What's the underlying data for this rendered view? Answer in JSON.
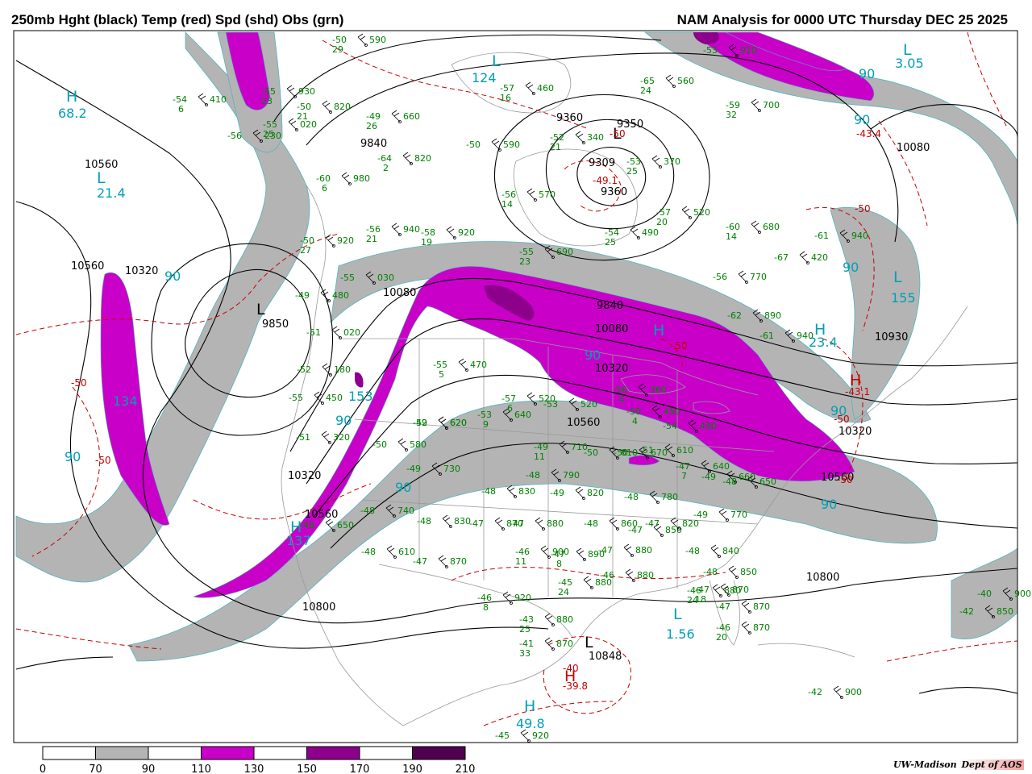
{
  "header": {
    "left_title": "250mb Hght (black) Temp (red) Spd (shd) Obs (grn)",
    "right_title": "NAM Analysis for 0000 UTC Thursday  DEC 25 2025"
  },
  "credit": {
    "org": "UW-Madison",
    "dept": "Dept of AOS"
  },
  "colors": {
    "speed_70_90": "#b4b4b4",
    "speed_110_130": "#c800c8",
    "speed_150_170": "#8c008c",
    "speed_190_210": "#500050",
    "height": "#000000",
    "temperature": "#c80000",
    "observations": "#008000",
    "speed_labels": "#00a0b4",
    "borders": "#999999"
  },
  "legend": {
    "ticks": [
      "0",
      "70",
      "90",
      "110",
      "130",
      "150",
      "170",
      "190",
      "210"
    ],
    "swatches": [
      "#ffffff",
      "#b4b4b4",
      "#ffffff",
      "#c800c8",
      "#ffffff",
      "#8c008c",
      "#ffffff",
      "#500050",
      "#ffffff"
    ]
  },
  "height_labels": [
    "10560",
    "9840",
    "10560",
    "10320",
    "9850",
    "9360",
    "9350",
    "9309",
    "9360",
    "10080",
    "9840",
    "10080",
    "10320",
    "10560",
    "10080",
    "10930",
    "10320",
    "10560",
    "10320",
    "10560",
    "10800",
    "10800",
    "10848"
  ],
  "speed_labels": [
    "68.2",
    "21.4",
    "90",
    "124",
    "90",
    "134",
    "90",
    "153",
    "90",
    "90",
    "137",
    "90",
    "3.05",
    "90",
    "90",
    "155",
    "23.4",
    "90",
    "90",
    "1.56",
    "49.8"
  ],
  "pressure_centers": [
    {
      "letter": "H",
      "kind": "speed"
    },
    {
      "letter": "L",
      "kind": "speed"
    },
    {
      "letter": "L",
      "kind": "height"
    },
    {
      "letter": "L",
      "kind": "height"
    },
    {
      "letter": "L",
      "kind": "speed"
    },
    {
      "letter": "H",
      "kind": "speed"
    },
    {
      "letter": "H",
      "kind": "speed"
    },
    {
      "letter": "L",
      "kind": "speed"
    },
    {
      "letter": "H",
      "kind": "speed"
    },
    {
      "letter": "L",
      "kind": "speed"
    },
    {
      "letter": "H",
      "kind": "temperature"
    },
    {
      "letter": "H",
      "kind": "temperature"
    },
    {
      "letter": "L",
      "kind": "height"
    },
    {
      "letter": "L",
      "kind": "speed"
    },
    {
      "letter": "H",
      "kind": "speed"
    }
  ],
  "temperature_labels": [
    "-50",
    "-50",
    "-49.1",
    "-50",
    "-43.4",
    "-50",
    "-50",
    "-43.1",
    "-50",
    "-50",
    "-40",
    "-39.8"
  ],
  "observations": [
    {
      "temp": "-54",
      "hgt": "410",
      "dew": "6"
    },
    {
      "temp": "-50",
      "hgt": "590",
      "dew": "29"
    },
    {
      "temp": "-55",
      "hgt": "930",
      "dew": "23"
    },
    {
      "temp": "-50",
      "hgt": "820",
      "dew": "21"
    },
    {
      "temp": "-55",
      "hgt": "020",
      "dew": "25"
    },
    {
      "temp": "-56",
      "hgt": "230",
      "dew": ""
    },
    {
      "temp": "-49",
      "hgt": "660",
      "dew": "26"
    },
    {
      "temp": "-64",
      "hgt": "820",
      "dew": "2"
    },
    {
      "temp": "-60",
      "hgt": "980",
      "dew": "6"
    },
    {
      "temp": "-56",
      "hgt": "940",
      "dew": "21"
    },
    {
      "temp": "-50",
      "hgt": "920",
      "dew": "27"
    },
    {
      "temp": "-58",
      "hgt": "920",
      "dew": "19"
    },
    {
      "temp": "-55",
      "hgt": "030",
      "dew": ""
    },
    {
      "temp": "-49",
      "hgt": "480",
      "dew": ""
    },
    {
      "temp": "-51",
      "hgt": "020",
      "dew": ""
    },
    {
      "temp": "-52",
      "hgt": "180",
      "dew": ""
    },
    {
      "temp": "-55",
      "hgt": "450",
      "dew": ""
    },
    {
      "temp": "-51",
      "hgt": "320",
      "dew": ""
    },
    {
      "temp": "-50",
      "hgt": "580",
      "dew": ""
    },
    {
      "temp": "-49",
      "hgt": "620",
      "dew": ""
    },
    {
      "temp": "-48",
      "hgt": "740",
      "dew": ""
    },
    {
      "temp": "-48",
      "hgt": "650",
      "dew": ""
    },
    {
      "temp": "-57",
      "hgt": "460",
      "dew": "16"
    },
    {
      "temp": "-50",
      "hgt": "590",
      "dew": ""
    },
    {
      "temp": "-52",
      "hgt": "340",
      "dew": "21"
    },
    {
      "temp": "-53",
      "hgt": "370",
      "dew": "25"
    },
    {
      "temp": "-56",
      "hgt": "570",
      "dew": "14"
    },
    {
      "temp": "-55",
      "hgt": "690",
      "dew": "23"
    },
    {
      "temp": "-54",
      "hgt": "490",
      "dew": "25"
    },
    {
      "temp": "-57",
      "hgt": "520",
      "dew": "20"
    },
    {
      "temp": "-65",
      "hgt": "560",
      "dew": "24"
    },
    {
      "temp": "-53",
      "hgt": "910",
      "dew": ""
    },
    {
      "temp": "-59",
      "hgt": "700",
      "dew": "32"
    },
    {
      "temp": "-60",
      "hgt": "680",
      "dew": "14"
    },
    {
      "temp": "-61",
      "hgt": "940",
      "dew": ""
    },
    {
      "temp": "-67",
      "hgt": "420",
      "dew": ""
    },
    {
      "temp": "-56",
      "hgt": "770",
      "dew": ""
    },
    {
      "temp": "-62",
      "hgt": "890",
      "dew": ""
    },
    {
      "temp": "-61",
      "hgt": "940",
      "dew": ""
    },
    {
      "temp": "-55",
      "hgt": "470",
      "dew": "5"
    },
    {
      "temp": "-52",
      "hgt": "620",
      "dew": ""
    },
    {
      "temp": "-53",
      "hgt": "640",
      "dew": "9"
    },
    {
      "temp": "-57",
      "hgt": "520",
      "dew": "6"
    },
    {
      "temp": "-53",
      "hgt": "520",
      "dew": ""
    },
    {
      "temp": "-56",
      "hgt": "360",
      "dew": "4"
    },
    {
      "temp": "-50",
      "hgt": "450",
      "dew": "4"
    },
    {
      "temp": "-54",
      "hgt": "490",
      "dew": ""
    },
    {
      "temp": "-49",
      "hgt": "730",
      "dew": ""
    },
    {
      "temp": "-49",
      "hgt": "710",
      "dew": "11"
    },
    {
      "temp": "-50",
      "hgt": "610",
      "dew": ""
    },
    {
      "temp": "-50",
      "hgt": "670",
      "dew": ""
    },
    {
      "temp": "-51",
      "hgt": "610",
      "dew": ""
    },
    {
      "temp": "-48",
      "hgt": "830",
      "dew": ""
    },
    {
      "temp": "-48",
      "hgt": "790",
      "dew": ""
    },
    {
      "temp": "-49",
      "hgt": "820",
      "dew": ""
    },
    {
      "temp": "-48",
      "hgt": "780",
      "dew": ""
    },
    {
      "temp": "-47",
      "hgt": "640",
      "dew": "7"
    },
    {
      "temp": "-49",
      "hgt": "660",
      "dew": ""
    },
    {
      "temp": "-48",
      "hgt": "650",
      "dew": ""
    },
    {
      "temp": "-49",
      "hgt": "770",
      "dew": ""
    },
    {
      "temp": "-48",
      "hgt": "830",
      "dew": ""
    },
    {
      "temp": "-47",
      "hgt": "870",
      "dew": ""
    },
    {
      "temp": "-47",
      "hgt": "880",
      "dew": ""
    },
    {
      "temp": "-48",
      "hgt": "860",
      "dew": ""
    },
    {
      "temp": "-47",
      "hgt": "850",
      "dew": ""
    },
    {
      "temp": "-47",
      "hgt": "820",
      "dew": ""
    },
    {
      "temp": "-48",
      "hgt": "610",
      "dew": ""
    },
    {
      "temp": "-47",
      "hgt": "870",
      "dew": ""
    },
    {
      "temp": "-46",
      "hgt": "900",
      "dew": "11"
    },
    {
      "temp": "-47",
      "hgt": "890",
      "dew": "8"
    },
    {
      "temp": "-47",
      "hgt": "880",
      "dew": ""
    },
    {
      "temp": "-48",
      "hgt": "840",
      "dew": ""
    },
    {
      "temp": "-48",
      "hgt": "850",
      "dew": ""
    },
    {
      "temp": "-46",
      "hgt": "880",
      "dew": "24"
    },
    {
      "temp": "-46",
      "hgt": "880",
      "dew": ""
    },
    {
      "temp": "-45",
      "hgt": "880",
      "dew": "24"
    },
    {
      "temp": "-47",
      "hgt": "870",
      "dew": "18"
    },
    {
      "temp": "-47",
      "hgt": "870",
      "dew": ""
    },
    {
      "temp": "-46",
      "hgt": "920",
      "dew": "8"
    },
    {
      "temp": "-43",
      "hgt": "880",
      "dew": "25"
    },
    {
      "temp": "-46",
      "hgt": "870",
      "dew": "20"
    },
    {
      "temp": "-41",
      "hgt": "870",
      "dew": "33"
    },
    {
      "temp": "-42",
      "hgt": "850",
      "dew": ""
    },
    {
      "temp": "-40",
      "hgt": "900",
      "dew": ""
    },
    {
      "temp": "-42",
      "hgt": "900",
      "dew": ""
    },
    {
      "temp": "-45",
      "hgt": "920",
      "dew": ""
    }
  ]
}
